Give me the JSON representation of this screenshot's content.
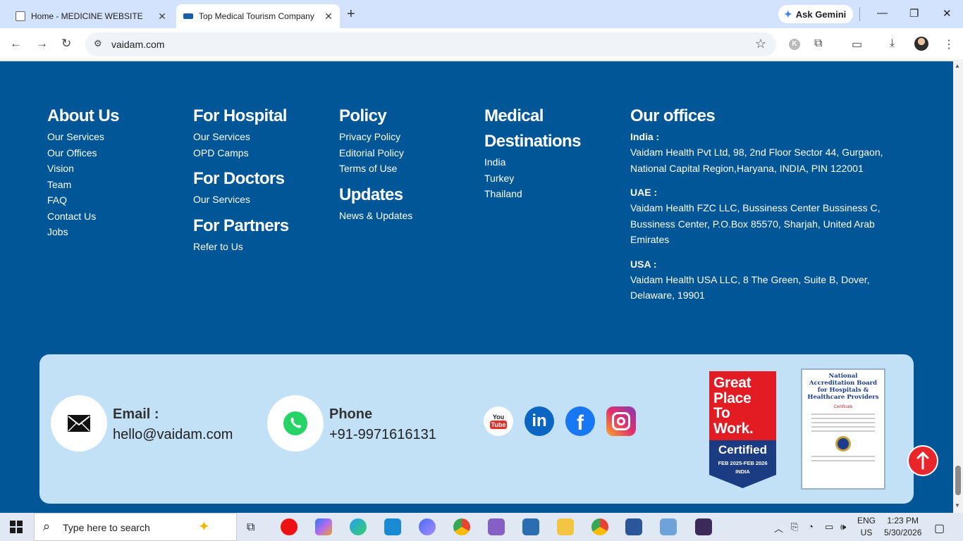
{
  "browser": {
    "tabs": [
      {
        "title": "Home - MEDICINE WEBSITE",
        "active": false
      },
      {
        "title": "Top Medical Tourism Company",
        "active": true
      }
    ],
    "new_tab": "+",
    "ask_gemini": "Ask Gemini",
    "url": "vaidam.com",
    "window_controls": {
      "minimize": "—",
      "restore": "❐",
      "close": "✕"
    }
  },
  "footer": {
    "about": {
      "heading": "About Us",
      "links": [
        "Our Services",
        "Our Offices",
        "Vision",
        "Team",
        "FAQ",
        "Contact Us",
        "Jobs"
      ]
    },
    "for_hospital": {
      "heading": "For Hospital",
      "links": [
        "Our Services",
        "OPD Camps"
      ]
    },
    "for_doctors": {
      "heading": "For Doctors",
      "links": [
        "Our Services"
      ]
    },
    "for_partners": {
      "heading": "For Partners",
      "links": [
        "Refer to Us"
      ]
    },
    "policy": {
      "heading": "Policy",
      "links": [
        "Privacy Policy",
        "Editorial Policy",
        "Terms of Use"
      ]
    },
    "updates": {
      "heading": "Updates",
      "links": [
        "News & Updates"
      ]
    },
    "destinations": {
      "heading_line1": "Medical",
      "heading_line2": "Destinations",
      "links": [
        "India",
        "Turkey",
        "Thailand"
      ]
    },
    "offices": {
      "heading": "Our offices",
      "india": {
        "label": "India :",
        "lines": [
          "Vaidam Health Pvt Ltd, 98, 2nd Floor Sector 44, Gurgaon,",
          "National Capital Region,Haryana, INDIA, PIN 122001"
        ]
      },
      "uae": {
        "label": "UAE :",
        "lines": [
          "Vaidam Health FZC LLC, Bussiness Center Bussiness C,",
          "Bussiness Center, P.O.Box 85570, Sharjah, United Arab",
          "Emirates"
        ]
      },
      "usa": {
        "label": "USA :",
        "lines": [
          "Vaidam Health USA LLC, 8 The Green, Suite B, Dover,",
          "Delaware, 19901"
        ]
      }
    }
  },
  "contact": {
    "email_label": "Email :",
    "email_value": "hello@vaidam.com",
    "phone_label": "Phone",
    "phone_value": "+91-9971616131",
    "social": [
      "youtube-icon",
      "linkedin-icon",
      "facebook-icon",
      "instagram-icon"
    ],
    "youtube_text": "You\nTube",
    "linkedin_text": "in",
    "facebook_text": "f",
    "gptw": {
      "line1": "Great",
      "line2": "Place",
      "line3": "To",
      "line4": "Work.",
      "certified": "Certified",
      "period": "FEB 2025-FEB 2026",
      "country": "INDIA"
    },
    "nabh": {
      "title": "National Accreditation Board for Hospitals & Healthcare Providers",
      "cert": "Certificate"
    }
  },
  "taskbar": {
    "search_placeholder": "Type here to search",
    "lang_line1": "ENG",
    "lang_line2": "US",
    "time": "1:23 PM",
    "date": "5/30/2026"
  },
  "colors": {
    "footer_bg": "#005697",
    "card_bg": "#c2e0f6",
    "accent_red": "#e8252b"
  }
}
